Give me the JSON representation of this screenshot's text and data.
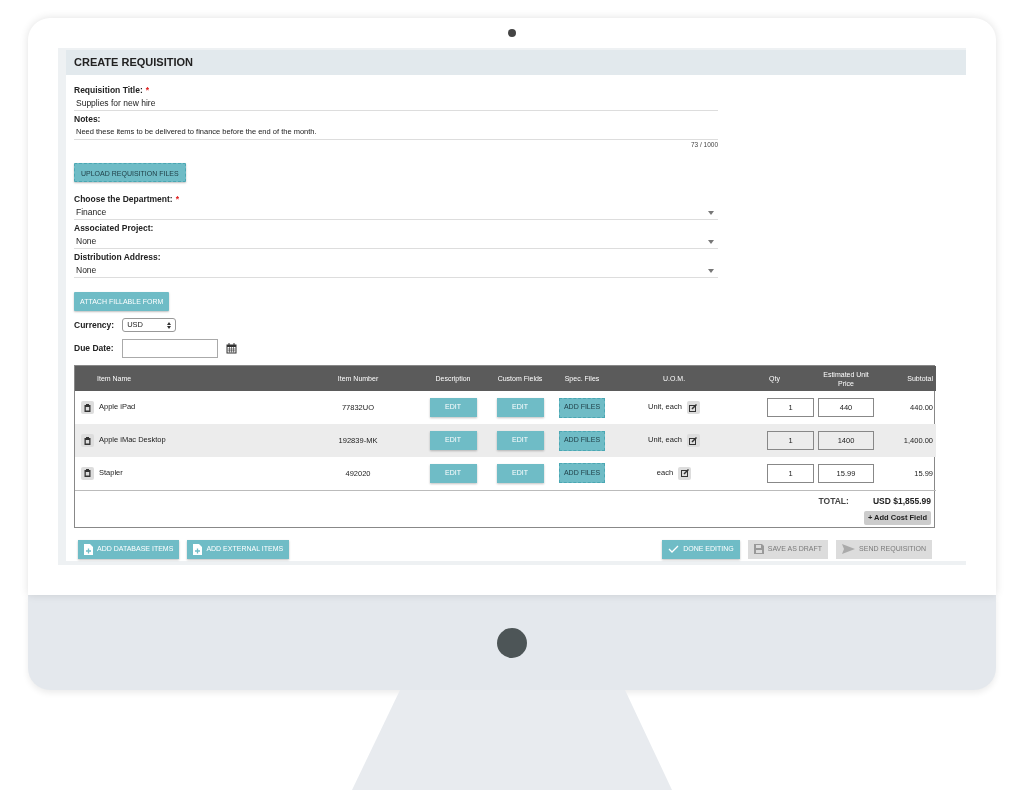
{
  "header": {
    "title": "CREATE REQUISITION"
  },
  "fields": [
    {
      "kind": "text",
      "label": "Requisition Title:",
      "required_mark": "*",
      "value": "Supplies for new hire"
    },
    {
      "kind": "notes",
      "label": "Notes:",
      "value": "Need these items to be delivered to finance before the end of the month.",
      "counter": "73 / 1000"
    },
    {
      "kind": "upload",
      "label": "UPLOAD REQUISITION FILES"
    },
    {
      "kind": "select",
      "label": "Choose the Department:",
      "required_mark": "*",
      "value": "Finance"
    },
    {
      "kind": "select",
      "label": "Associated Project:",
      "value": "None"
    },
    {
      "kind": "select",
      "label": "Distribution Address:",
      "value": "None"
    },
    {
      "kind": "button",
      "label": "ATTACH FILLABLE FORM"
    }
  ],
  "currency": {
    "label": "Currency:",
    "value": "USD"
  },
  "due_date": {
    "label": "Due Date:"
  },
  "table": {
    "columns": [
      "Item Name",
      "Item Number",
      "Description",
      "Custom Fields",
      "Spec. Files",
      "U.O.M.",
      "Qty",
      "Estimated Unit Price",
      "Subtotal"
    ],
    "rows": [
      {
        "item_name": "Apple iPad",
        "item_number": "77832UO",
        "description": "EDIT",
        "custom_fields": "EDIT",
        "spec_files": "ADD FILES",
        "uom": "Unit, each",
        "qty": "1",
        "unit_price": "440",
        "subtotal": "440.00"
      },
      {
        "item_name": "Apple iMac Desktop",
        "item_number": "192839-MK",
        "description": "EDIT",
        "custom_fields": "EDIT",
        "spec_files": "ADD FILES",
        "uom": "Unit, each",
        "qty": "1",
        "unit_price": "1400",
        "subtotal": "1,400.00"
      },
      {
        "item_name": "Stapler",
        "item_number": "492020",
        "description": "EDIT",
        "custom_fields": "EDIT",
        "spec_files": "ADD FILES",
        "uom": "each",
        "qty": "1",
        "unit_price": "15.99",
        "subtotal": "15.99"
      }
    ],
    "total_label": "TOTAL:",
    "total": "USD $1,855.99",
    "add_cost_field": "+ Add Cost Field"
  },
  "left_actions": [
    {
      "kind": "file",
      "label": "ADD DATABASE ITEMS",
      "disabled": false
    },
    {
      "kind": "file",
      "label": "ADD EXTERNAL ITEMS",
      "disabled": false
    }
  ],
  "right_actions": [
    {
      "kind": "check",
      "label": "DONE EDITING",
      "disabled": false
    },
    {
      "kind": "save",
      "label": "SAVE AS DRAFT",
      "disabled": true
    },
    {
      "kind": "send",
      "label": "SEND REQUISITION",
      "disabled": true
    }
  ]
}
